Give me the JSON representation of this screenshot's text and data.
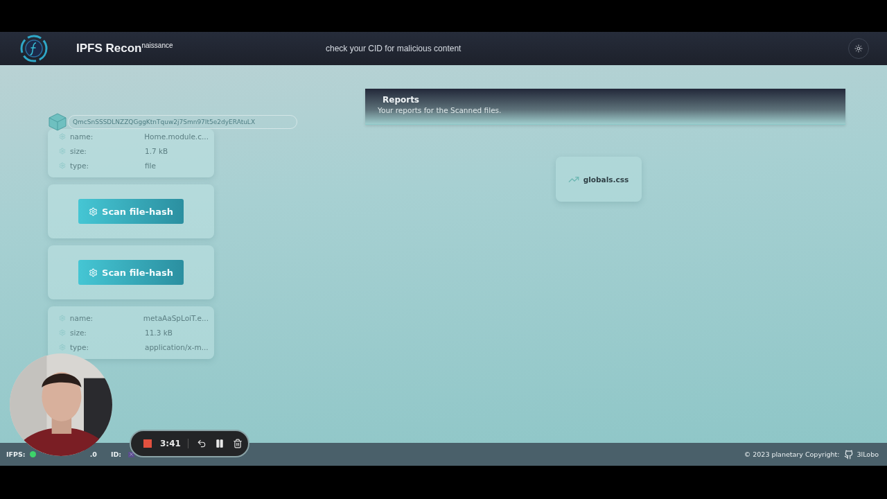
{
  "header": {
    "title": "IPFS Recon$^{naissance}$",
    "tagline": "check your CID for malicious content"
  },
  "cid": "QmcSnSSSDLNZZQGggKtnTquw2j7Smn97It5e2dyERAtuLX",
  "file_cards": [
    {
      "kind": "details",
      "rows": [
        {
          "label": "name:",
          "value": "Home.module.c..."
        },
        {
          "label": "size:",
          "value": "1.7 kB"
        },
        {
          "label": "type:",
          "value": "file"
        }
      ]
    },
    {
      "kind": "scan",
      "button": "Scan file-hash"
    },
    {
      "kind": "scan",
      "button": "Scan file-hash"
    },
    {
      "kind": "details",
      "rows": [
        {
          "label": "name:",
          "value": "metaAaSpLoiT.e..."
        },
        {
          "label": "size:",
          "value": "11.3 kB"
        },
        {
          "label": "type:",
          "value": "application/x-m..."
        }
      ]
    }
  ],
  "reports": {
    "title": "Reports",
    "subtitle": "Your reports for the Scanned files."
  },
  "report_items": [
    {
      "name": "globals.css"
    }
  ],
  "footer": {
    "ipfs_label": "IFPS:",
    "ipfs_online": true,
    "peers": ".0",
    "id_label": "ID:",
    "copyright": "© 2023 planetary Copyright:",
    "github_user": "3lLobo"
  },
  "recorder": {
    "time": "3:41"
  }
}
